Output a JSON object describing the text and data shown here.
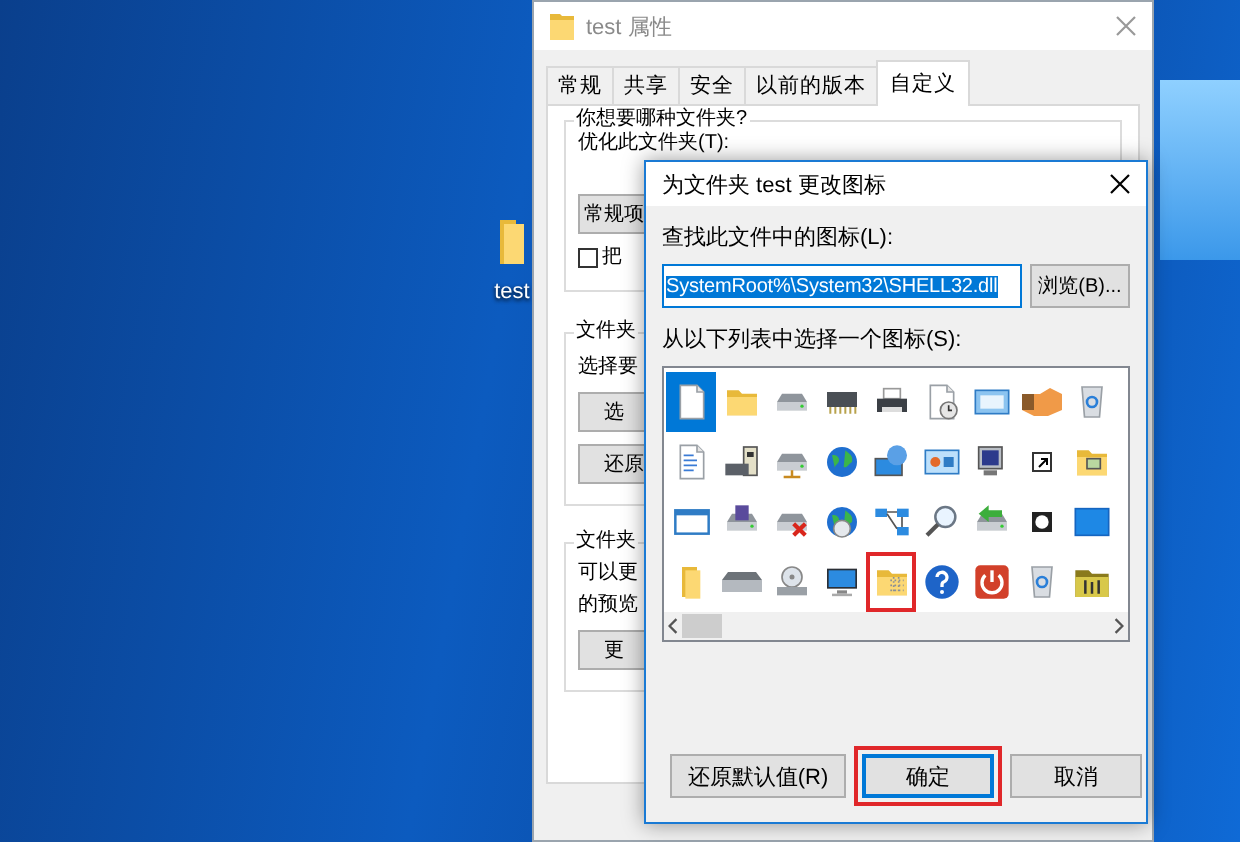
{
  "desktop_icons": [
    {
      "label": "test"
    }
  ],
  "properties_window": {
    "title": "test 属性",
    "tabs": [
      {
        "label": "常规",
        "selected": false
      },
      {
        "label": "共享",
        "selected": false
      },
      {
        "label": "安全",
        "selected": false
      },
      {
        "label": "以前的版本",
        "selected": false
      },
      {
        "label": "自定义",
        "selected": true
      }
    ],
    "group_1": {
      "legend": "你想要哪种文件夹?",
      "label": "优化此文件夹(T):",
      "dropdown_value": "常规项",
      "checkbox": {
        "label": "把",
        "checked": false
      }
    },
    "group_2": {
      "legend": "文件夹",
      "text": "选择要",
      "buttons": [
        "选",
        "还原"
      ]
    },
    "group_3": {
      "legend": "文件夹",
      "lines": [
        "可以更",
        "的预览"
      ],
      "button": "更"
    }
  },
  "icon_dialog": {
    "title": "为文件夹 test 更改图标",
    "file_label": "查找此文件中的图标(L):",
    "file_value": "SystemRoot%\\System32\\SHELL32.dll",
    "browse_button": "浏览(B)...",
    "list_label": "从以下列表中选择一个图标(S):",
    "icons": [
      {
        "selected": true,
        "highlighted": false
      },
      {
        "selected": false,
        "highlighted": false
      },
      {
        "selected": false,
        "highlighted": false
      },
      {
        "selected": false,
        "highlighted": false
      },
      {
        "selected": false,
        "highlighted": false
      },
      {
        "selected": false,
        "highlighted": false
      },
      {
        "selected": false,
        "highlighted": false
      },
      {
        "selected": false,
        "highlighted": false
      },
      {
        "selected": false,
        "highlighted": false
      },
      {
        "selected": false,
        "highlighted": false
      },
      {
        "selected": false,
        "highlighted": false
      },
      {
        "selected": false,
        "highlighted": false
      },
      {
        "selected": false,
        "highlighted": false
      },
      {
        "selected": false,
        "highlighted": false
      },
      {
        "selected": false,
        "highlighted": false
      },
      {
        "selected": false,
        "highlighted": false
      },
      {
        "selected": false,
        "highlighted": false
      },
      {
        "selected": false,
        "highlighted": false
      },
      {
        "selected": false,
        "highlighted": false
      },
      {
        "selected": false,
        "highlighted": false
      },
      {
        "selected": false,
        "highlighted": false
      },
      {
        "selected": false,
        "highlighted": false
      },
      {
        "selected": false,
        "highlighted": false
      },
      {
        "selected": false,
        "highlighted": false
      },
      {
        "selected": false,
        "highlighted": false
      },
      {
        "selected": false,
        "highlighted": false
      },
      {
        "selected": false,
        "highlighted": false
      },
      {
        "selected": false,
        "highlighted": false
      },
      {
        "selected": false,
        "highlighted": false
      },
      {
        "selected": false,
        "highlighted": false
      },
      {
        "selected": false,
        "highlighted": false
      },
      {
        "selected": false,
        "highlighted": true
      },
      {
        "selected": false,
        "highlighted": false
      },
      {
        "selected": false,
        "highlighted": false
      },
      {
        "selected": false,
        "highlighted": false
      },
      {
        "selected": false,
        "highlighted": false
      }
    ],
    "buttons": [
      {
        "label": "还原默认值(R)",
        "default": false,
        "highlighted": false
      },
      {
        "label": "确定",
        "default": true,
        "highlighted": true
      },
      {
        "label": "取消",
        "default": false,
        "highlighted": false
      }
    ]
  }
}
